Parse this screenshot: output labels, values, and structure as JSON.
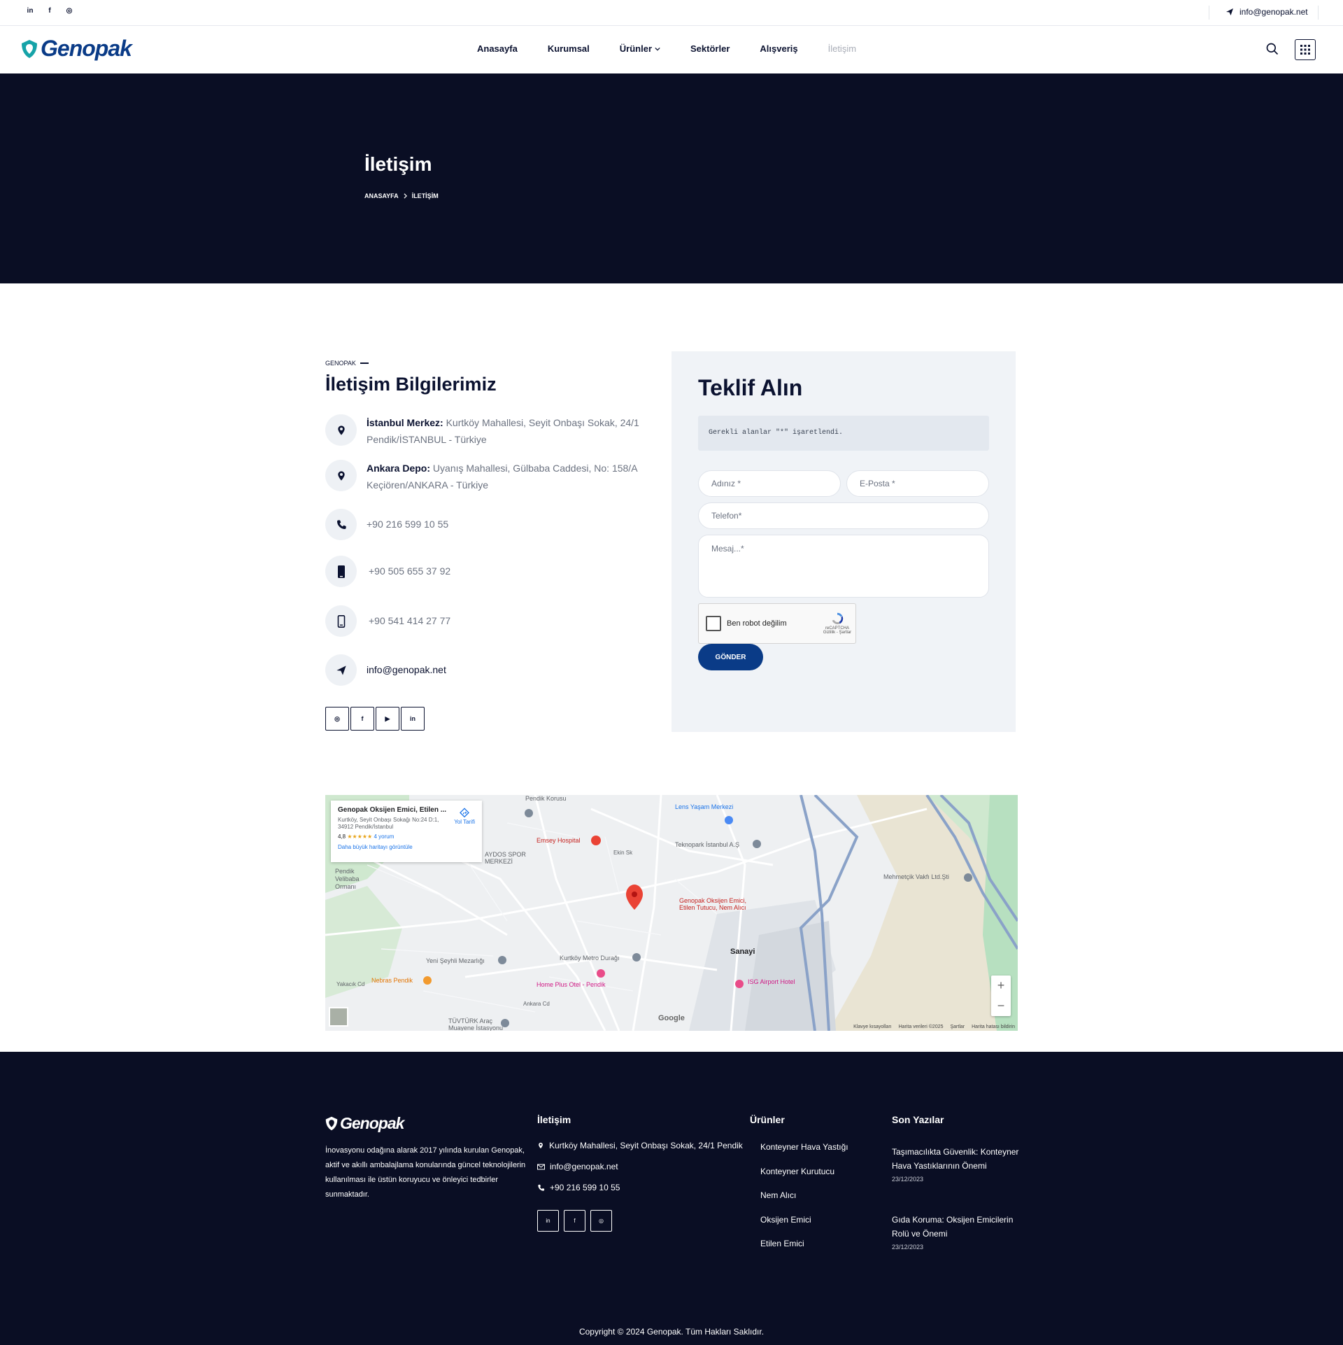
{
  "topbar": {
    "social": [
      "in",
      "f",
      "◎"
    ],
    "email": "info@genopak.net"
  },
  "brand": {
    "name": "Genopak",
    "color": "#0a3b87"
  },
  "nav": {
    "items": [
      "Anasayfa",
      "Kurumsal",
      "Ürünler",
      "Sektörler",
      "Alışveriş",
      "İletişim"
    ],
    "active": "İletişim"
  },
  "hero": {
    "title": "İletişim",
    "breadcrumb": [
      "ANASAYFA",
      "İLETİŞİM"
    ]
  },
  "contact": {
    "eyebrow": "GENOPAK",
    "heading": "İletişim Bilgilerimiz",
    "istanbul_label": "İstanbul Merkez:",
    "istanbul_addr_1": " Kurtköy Mahallesi, Seyit Onbaşı Sokak, 24/1",
    "istanbul_addr_2": "Pendik/İSTANBUL - Türkiye",
    "ankara_label": "Ankara Depo:",
    "ankara_addr_1": " Uyanış Mahallesi, Gülbaba Caddesi, No: 158/A",
    "ankara_addr_2": "Keçiören/ANKARA - Türkiye",
    "phone1": "+90 216 599 10 55",
    "phone2": "+90 505 655 37 92",
    "phone3": "+90 541 414 27 77",
    "email": "info@genopak.net",
    "social_icons": [
      "instagram-icon",
      "facebook-icon",
      "youtube-icon",
      "linkedin-icon"
    ]
  },
  "form": {
    "title": "Teklif Alın",
    "required_note": "Gerekli alanlar \"*\" işaretlendi.",
    "name_placeholder": "Adınız *",
    "email_placeholder": "E-Posta *",
    "phone_placeholder": "Telefon*",
    "message_placeholder": "Mesaj...*",
    "captcha_label": "Ben robot değilim",
    "captcha_brand": "reCAPTCHA",
    "captcha_links": "Gizlilik - Şartlar",
    "submit": "GÖNDER"
  },
  "map": {
    "card_title": "Genopak Oksijen Emici, Etilen ...",
    "card_address": "Kurtköy, Seyit Onbaşı Sokağı No:24 D:1, 34912 Pendik/İstanbul",
    "card_rating": "4,8",
    "card_stars": "★★★★★",
    "card_reviews": "4 yorum",
    "card_link": "Daha büyük haritayı görüntüle",
    "directions": "Yol Tarifi",
    "labels": {
      "pendik_korusu": "Pendik Korusu",
      "emsey": "Emsey Hospital",
      "lens": "Lens Yaşam Merkezi",
      "teknopark": "Teknopark İstanbul A.Ş",
      "aydos": "AYDOS SPOR MERKEZİ",
      "velibaba": "Pendik Velibaba Ormanı",
      "mehmetcik": "Mehmetçik Vakfı Ltd.Şti",
      "pin": "Genopak Oksijen Emici, Etilen Tutucu, Nem Alıcı",
      "sanayi": "Sanayi",
      "metro": "Kurtköy Metro Durağı",
      "seyhli": "Yeni Şeyhli Mezarlığı",
      "nebras": "Nebras Pendik",
      "homeplus": "Home Plus Otel - Pendik",
      "isg": "ISG Airport Hotel",
      "tuvturk": "TÜVTÜRK Araç Muayene İstasyonu",
      "yakacik": "Yakacık Cd",
      "ankara_cd": "Ankara Cd",
      "ekin": "Ekin Sk"
    },
    "zoom_in": "+",
    "zoom_out": "−",
    "google": "Google",
    "attribution": [
      "Klavye kısayolları",
      "Harita verileri ©2025",
      "Şartlar",
      "Harita hatası bildirin"
    ]
  },
  "footer": {
    "about": "İnovasyonu odağına alarak 2017 yılında kurulan Genopak, aktif ve akıllı ambalajlama konularında güncel teknolojilerin kullanılması ile üstün koruyucu ve önleyici tedbirler sunmaktadır.",
    "contact_heading": "İletişim",
    "address": "Kurtköy Mahallesi, Seyit Onbaşı Sokak, 24/1 Pendik",
    "email": "info@genopak.net",
    "phone": "+90 216 599 10 55",
    "products_heading": "Ürünler",
    "products": [
      "Konteyner Hava Yastığı",
      "Konteyner Kurutucu",
      "Nem Alıcı",
      "Oksijen Emici",
      "Etilen Emici"
    ],
    "posts_heading": "Son Yazılar",
    "posts": [
      {
        "title": "Taşımacılıkta Güvenlik: Konteyner Hava Yastıklarının Önemi",
        "date": "23/12/2023"
      },
      {
        "title": "Gıda Koruma: Oksijen Emicilerin Rolü ve Önemi",
        "date": "23/12/2023"
      }
    ],
    "copyright": "Copyright © 2024 Genopak. Tüm Hakları Saklıdır."
  }
}
